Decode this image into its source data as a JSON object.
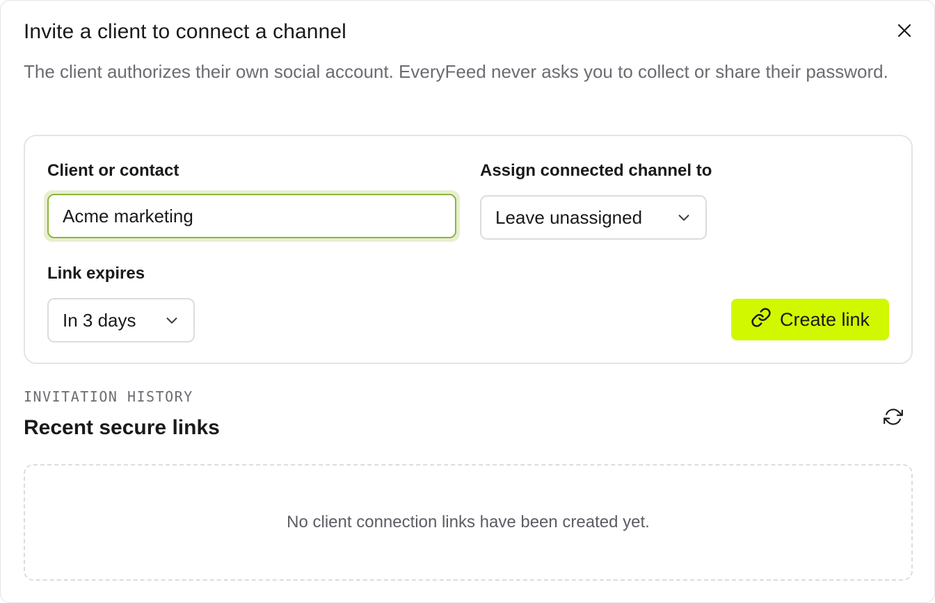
{
  "dialog": {
    "title": "Invite a client to connect a channel",
    "subtitle": "The client authorizes their own social account. EveryFeed never asks you to collect or share their password.",
    "close_icon": "close-icon"
  },
  "form": {
    "client_label": "Client or contact",
    "client_value": "Acme marketing",
    "assign_label": "Assign connected channel to",
    "assign_value": "Leave unassigned",
    "expires_label": "Link expires",
    "expires_value": "In 3 days",
    "create_label": "Create link",
    "create_icon": "link-icon",
    "accent_color": "#d2f800"
  },
  "history": {
    "eyebrow": "INVITATION HISTORY",
    "title": "Recent secure links",
    "refresh_icon": "refresh-icon",
    "empty_text": "No client connection links have been created yet."
  }
}
